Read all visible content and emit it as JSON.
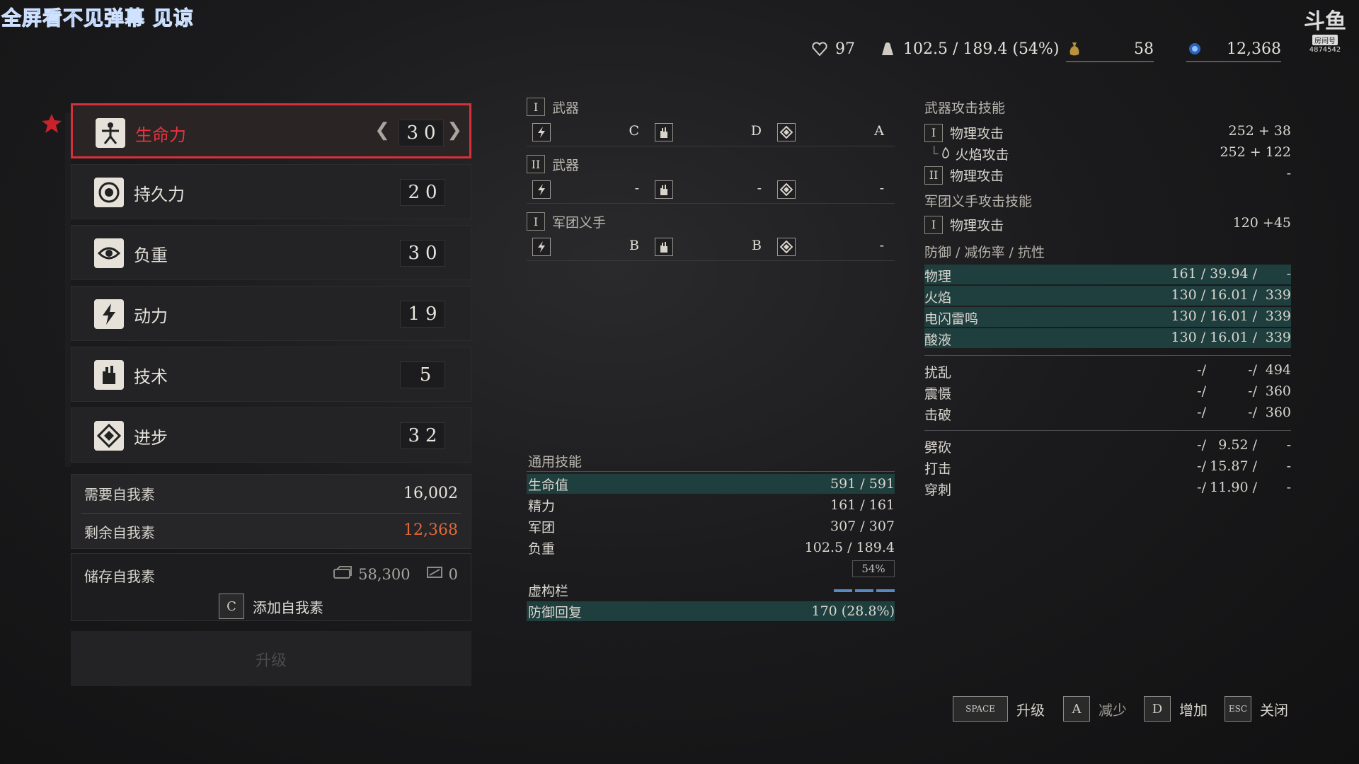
{
  "overlay": {
    "watermark": "全屏看不见弹幕 见谅",
    "platform_logo": "斗鱼",
    "room_label": "房间号",
    "room_number": "4874542"
  },
  "status": {
    "level": "97",
    "weight": "102.5 / 189.4 (54%)",
    "consumable_count": "58",
    "ergo": "12,368"
  },
  "attributes": [
    {
      "name": "生命力",
      "value": [
        "3",
        "0"
      ],
      "icon": "vitruvian-icon",
      "selected": true
    },
    {
      "name": "持久力",
      "value": [
        "2",
        "0"
      ],
      "icon": "target-icon"
    },
    {
      "name": "负重",
      "value": [
        "3",
        "0"
      ],
      "icon": "eye-icon"
    },
    {
      "name": "动力",
      "value": [
        "1",
        "9"
      ],
      "icon": "lightning-icon"
    },
    {
      "name": "技术",
      "value": [
        "",
        "5"
      ],
      "icon": "hand-icon"
    },
    {
      "name": "进步",
      "value": [
        "3",
        "2"
      ],
      "icon": "diamond-icon"
    }
  ],
  "ergo_box": {
    "required_label": "需要自我素",
    "required_value": "16,002",
    "remaining_label": "剩余自我素",
    "remaining_value": "12,368",
    "stored_label": "储存自我素",
    "stored_value": "58,300",
    "stored_extra": "0",
    "add_key": "C",
    "add_label": "添加自我素",
    "upgrade_label": "升级"
  },
  "scaling": {
    "weapon1_roman": "I",
    "weapon1_label": "武器",
    "weapon1_grades": [
      "C",
      "D",
      "A"
    ],
    "weapon2_roman": "II",
    "weapon2_label": "武器",
    "weapon2_grades": [
      "-",
      "-",
      "-"
    ],
    "legion_roman": "I",
    "legion_label": "军团义手",
    "legion_grades": [
      "B",
      "B",
      "-"
    ]
  },
  "general": {
    "title": "通用技能",
    "rows": [
      {
        "label": "生命值",
        "value": "591 /    591",
        "hl": true
      },
      {
        "label": "精力",
        "value": "161 /    161"
      },
      {
        "label": "军团",
        "value": "307 /    307"
      },
      {
        "label": "负重",
        "value": "102.5 / 189.4"
      }
    ],
    "weight_pct": "54%",
    "virtual_label": "虚构栏",
    "guard_label": "防御回复",
    "guard_value": "170 (28.8%)"
  },
  "attack": {
    "title": "武器攻击技能",
    "rows": [
      {
        "roman": "I",
        "label": "物理攻击",
        "value": "252 + 38"
      },
      {
        "roman": "",
        "label": "火焰攻击",
        "value": "252 + 122",
        "sub": true
      },
      {
        "roman": "II",
        "label": "物理攻击",
        "value": "-"
      }
    ],
    "legion_title": "军团义手攻击技能",
    "legion_row": {
      "roman": "I",
      "label": "物理攻击",
      "value": "120 +45"
    },
    "defense_title": "防御 / 减伤率 / 抗性",
    "defense_rows": [
      {
        "label": "物理",
        "a": "161 / 39.94 /",
        "b": "-"
      },
      {
        "label": "火焰",
        "a": "130 / 16.01 /",
        "b": "339"
      },
      {
        "label": "电闪雷鸣",
        "a": "130 / 16.01 /",
        "b": "339"
      },
      {
        "label": "酸液",
        "a": "130 / 16.01 /",
        "b": "339"
      }
    ],
    "resist_rows": [
      {
        "label": "扰乱",
        "a": "-/",
        "b": "-/",
        "c": "494"
      },
      {
        "label": "震慑",
        "a": "-/",
        "b": "-/",
        "c": "360"
      },
      {
        "label": "击破",
        "a": "-/",
        "b": "-/",
        "c": "360"
      }
    ],
    "damage_rows": [
      {
        "label": "劈砍",
        "a": "-/",
        "b": "9.52 /",
        "c": "-"
      },
      {
        "label": "打击",
        "a": "-/",
        "b": "15.87 /",
        "c": "-"
      },
      {
        "label": "穿刺",
        "a": "-/",
        "b": "11.90 /",
        "c": "-"
      }
    ]
  },
  "hints": {
    "space_key": "SPACE",
    "space_label": "升级",
    "a_key": "A",
    "a_label": "减少",
    "d_key": "D",
    "d_label": "增加",
    "esc_key": "ESC",
    "esc_label": "关闭"
  }
}
